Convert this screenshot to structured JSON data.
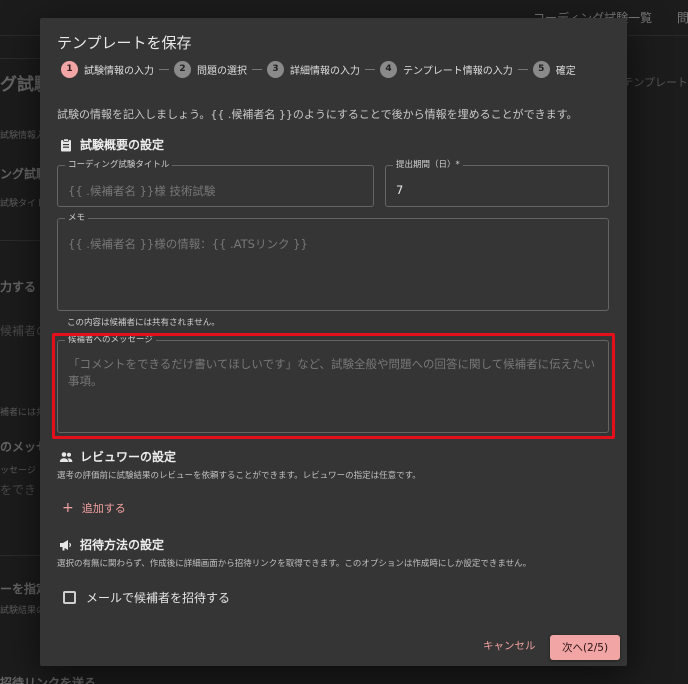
{
  "background": {
    "nav_links": [
      "コーディング試験一覧",
      "問"
    ],
    "fragments": {
      "heading_1": "グ試験",
      "label_1": "試験情報入力",
      "heading_2": "ング試験",
      "label_2": "試験タイト",
      "heading_3": "力する",
      "placeholder_1": "候補者の",
      "note_1": "補者には共",
      "heading_4": "のメッセ",
      "label_3": "ッセージ",
      "placeholder_2": "をでき",
      "heading_5": "ーを指定",
      "label_4": "試験結果の",
      "heading_6": "招待リンクを送る",
      "right_link": "テンプレート"
    }
  },
  "dialog": {
    "title": "テンプレートを保存",
    "steps": [
      {
        "num": "1",
        "label": "試験情報の入力"
      },
      {
        "num": "2",
        "label": "問題の選択"
      },
      {
        "num": "3",
        "label": "詳細情報の入力"
      },
      {
        "num": "4",
        "label": "テンプレート情報の入力"
      },
      {
        "num": "5",
        "label": "確定"
      }
    ],
    "intro": "試験の情報を記入しましょう。{{ .候補者名 }}のようにすることで後から情報を埋めることができます。",
    "overview": {
      "heading": "試験概要の設定",
      "title_field": {
        "label": "コーディング試験タイトル",
        "placeholder": "{{ .候補者名 }}様 技術試験"
      },
      "period_field": {
        "label": "提出期間（日）*",
        "value": "7"
      },
      "memo_field": {
        "label": "メモ",
        "placeholder": "{{ .候補者名 }}様の情報：{{ .ATSリンク }}"
      },
      "memo_helper": "この内容は候補者には共有されません。",
      "message_field": {
        "label": "候補者へのメッセージ",
        "placeholder": "「コメントをできるだけ書いてほしいです」など、試験全般や問題への回答に関して候補者に伝えたい事項。"
      }
    },
    "reviewer": {
      "heading": "レビュワーの設定",
      "description": "選考の評価前に試験結果のレビューを依頼することができます。レビュワーの指定は任意です。",
      "add_label": "追加する"
    },
    "invite": {
      "heading": "招待方法の設定",
      "description": "選択の有無に関わらず、作成後に詳細画面から招待リンクを取得できます。このオプションは作成時にしか設定できません。",
      "checkbox_label": "メールで候補者を招待する"
    },
    "actions": {
      "cancel": "キャンセル",
      "next": "次へ(2/5)"
    }
  },
  "colors": {
    "accent": "#f2a5a5",
    "highlight": "#e3101c",
    "dialog_bg": "#353535"
  }
}
